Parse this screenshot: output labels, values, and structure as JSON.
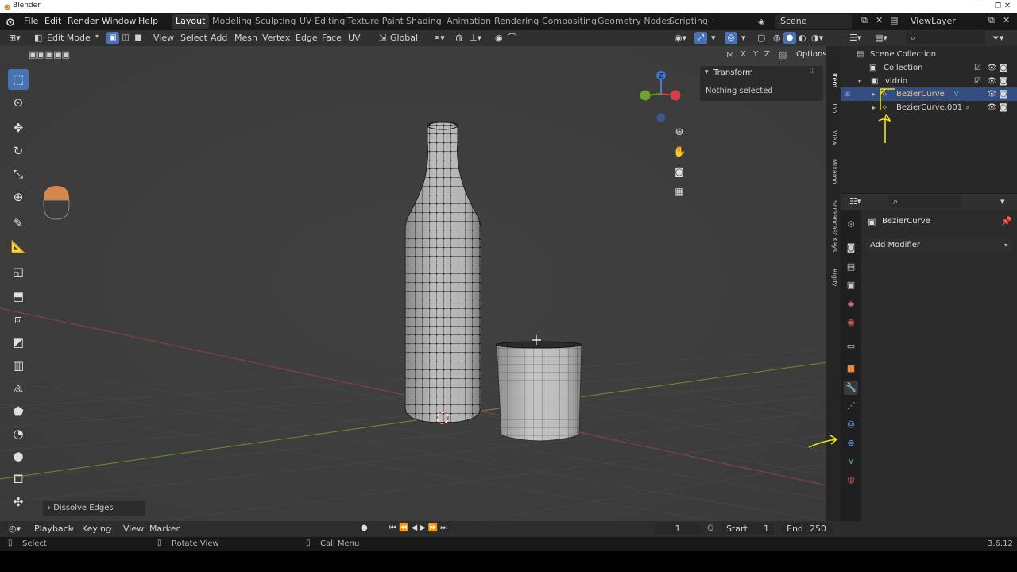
{
  "os": {
    "title": "Blender",
    "minimize": "–",
    "maximize": "❐",
    "close": "✕"
  },
  "menu": {
    "file": "File",
    "edit": "Edit",
    "render": "Render",
    "window": "Window",
    "help": "Help"
  },
  "workspaces": [
    "Layout",
    "Modeling",
    "Sculpting",
    "UV Editing",
    "Texture Paint",
    "Shading",
    "Animation",
    "Rendering",
    "Compositing",
    "Geometry Nodes",
    "Scripting"
  ],
  "workspace_add": "+",
  "scene": {
    "name": "Scene",
    "view_layer": "ViewLayer"
  },
  "viewport_header": {
    "mode": "Edit Mode",
    "menus": [
      "View",
      "Select",
      "Add",
      "Mesh",
      "Vertex",
      "Edge",
      "Face",
      "UV"
    ],
    "orientation": "Global",
    "options": "Options",
    "axes": [
      "X",
      "Y",
      "Z"
    ]
  },
  "gizmo": {
    "z": "Z"
  },
  "npanel": {
    "section": "Transform",
    "message": "Nothing selected",
    "tabs": [
      "Item",
      "Tool",
      "View",
      "Mixamo",
      "Screencast Keys",
      "Rigify"
    ]
  },
  "last_operator": "Dissolve Edges",
  "outliner": {
    "rows": [
      {
        "label": "Scene Collection"
      },
      {
        "label": "Collection"
      },
      {
        "label": "vidrio"
      },
      {
        "label": "BezierCurve"
      },
      {
        "label": "BezierCurve.001"
      }
    ]
  },
  "properties": {
    "object_name": "BezierCurve",
    "add_modifier": "Add Modifier"
  },
  "timeline": {
    "menus": [
      "Playback",
      "Keying",
      "View",
      "Marker"
    ],
    "current_frame": "1",
    "start_label": "Start",
    "start": "1",
    "end_label": "End",
    "end": "250"
  },
  "status": {
    "select": "Select",
    "rotate": "Rotate View",
    "call_menu": "Call Menu",
    "version": "3.6.12"
  },
  "colors": {
    "accent": "#4772b3",
    "selected_row": "#334d80",
    "annotation": "#f2e600",
    "axis_x": "#b84a4a",
    "axis_y": "#6a9a2a"
  }
}
